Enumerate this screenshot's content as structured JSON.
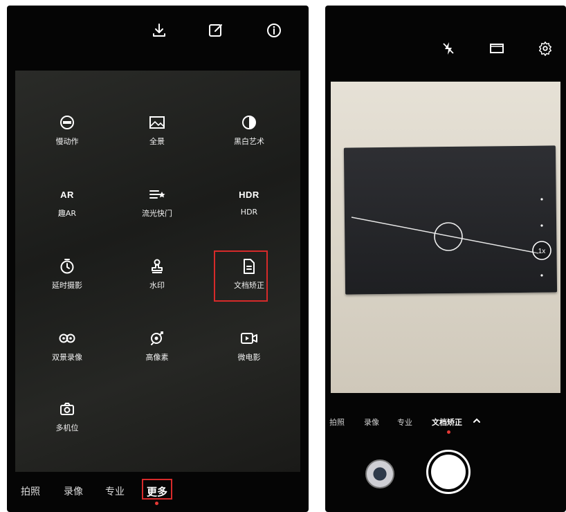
{
  "left_screen": {
    "toolbar": {
      "download_icon": "download-icon",
      "edit_icon": "edit-icon",
      "info_icon": "info-icon"
    },
    "modes": [
      {
        "label": "慢动作",
        "icon": "slow-motion-icon"
      },
      {
        "label": "全景",
        "icon": "panorama-icon"
      },
      {
        "label": "黑白艺术",
        "icon": "black-white-icon"
      },
      {
        "label": "趣AR",
        "icon_text": "AR"
      },
      {
        "label": "流光快门",
        "icon": "light-painting-icon"
      },
      {
        "label": "HDR",
        "icon_text": "HDR"
      },
      {
        "label": "延时摄影",
        "icon": "timelapse-icon"
      },
      {
        "label": "水印",
        "icon": "watermark-icon"
      },
      {
        "label": "文档矫正",
        "icon": "document-icon",
        "highlighted": true
      },
      {
        "label": "双景录像",
        "icon": "dual-view-icon"
      },
      {
        "label": "高像素",
        "icon": "high-pixel-icon"
      },
      {
        "label": "微电影",
        "icon": "micro-movie-icon"
      },
      {
        "label": "多机位",
        "icon": "multi-camera-icon"
      }
    ],
    "tabs": [
      {
        "label": "拍照"
      },
      {
        "label": "录像"
      },
      {
        "label": "专业"
      },
      {
        "label": "更多",
        "active": true
      }
    ]
  },
  "right_screen": {
    "toolbar": {
      "flash_icon": "flash-off-icon",
      "ratio_icon": "aspect-ratio-icon",
      "settings_icon": "settings-icon"
    },
    "zoom_label": "1x",
    "tabs": [
      {
        "label": "拍照"
      },
      {
        "label": "录像"
      },
      {
        "label": "专业"
      },
      {
        "label": "文档矫正",
        "active": true
      }
    ],
    "accent_color": "#e53935",
    "highlight_color": "#d72a2a"
  }
}
